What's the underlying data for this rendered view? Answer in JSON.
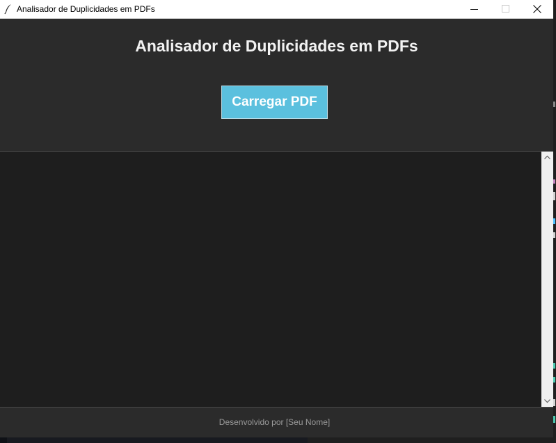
{
  "window": {
    "title": "Analisador de Duplicidades em PDFs",
    "icon": "feather-icon",
    "controls": [
      "minimize-icon",
      "maximize-icon",
      "close-icon"
    ]
  },
  "header": {
    "heading": "Analisador de Duplicidades em PDFs",
    "load_button_label": "Carregar PDF"
  },
  "output": {
    "text": ""
  },
  "footer": {
    "credit": "Desenvolvido por [Seu Nome]"
  },
  "colors": {
    "window_bg": "#2b2b2b",
    "output_bg": "#1e1e1e",
    "accent_button": "#5bc0de",
    "heading_text": "#f2f2f2",
    "footer_text": "#9a9a9a"
  }
}
